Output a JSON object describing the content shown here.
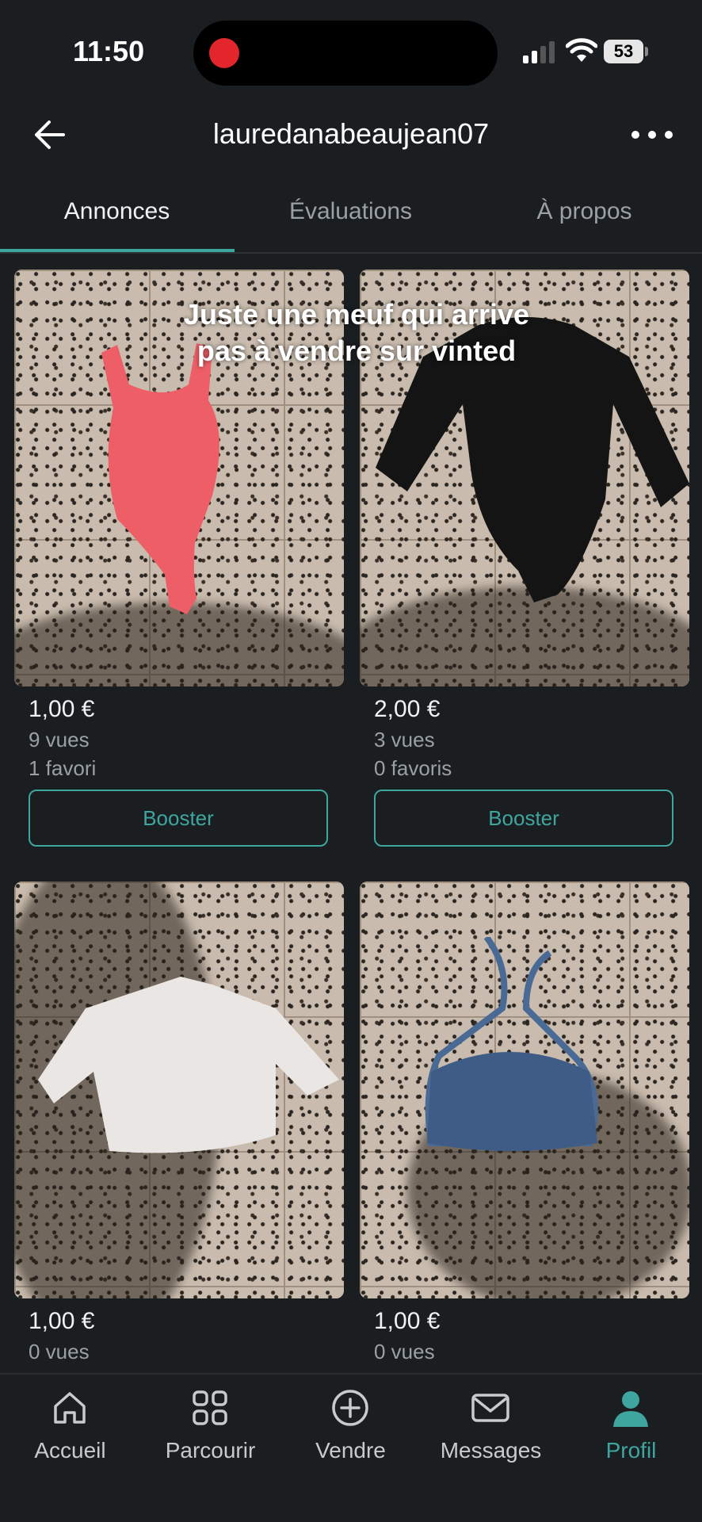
{
  "status": {
    "time": "11:50",
    "battery": "53"
  },
  "header": {
    "username": "lauredanabeaujean07"
  },
  "tabs": [
    {
      "label": "Annonces",
      "active": true
    },
    {
      "label": "Évaluations",
      "active": false
    },
    {
      "label": "À propos",
      "active": false
    }
  ],
  "overlay_caption": {
    "line1": "Juste une meuf qui arrive",
    "line2": "pas à vendre sur vinted"
  },
  "listings": [
    {
      "price": "1,00 €",
      "views": "9 vues",
      "favorites": "1 favori",
      "booster_label": "Booster",
      "garment_color": "#ee5e66"
    },
    {
      "price": "2,00 €",
      "views": "3 vues",
      "favorites": "0 favoris",
      "booster_label": "Booster",
      "garment_color": "#141414"
    },
    {
      "price": "1,00 €",
      "views": "0 vues",
      "garment_color": "#e9e6e3"
    },
    {
      "price": "1,00 €",
      "views": "0 vues",
      "garment_color": "#3f5c86"
    }
  ],
  "bottom_nav": [
    {
      "label": "Accueil",
      "icon": "home-icon",
      "active": false
    },
    {
      "label": "Parcourir",
      "icon": "grid-icon",
      "active": false
    },
    {
      "label": "Vendre",
      "icon": "plus-circle-icon",
      "active": false
    },
    {
      "label": "Messages",
      "icon": "envelope-icon",
      "active": false
    },
    {
      "label": "Profil",
      "icon": "person-icon",
      "active": true
    }
  ],
  "colors": {
    "accent": "#3fa59f",
    "background": "#1b1e21",
    "record_dot": "#e3262b"
  }
}
